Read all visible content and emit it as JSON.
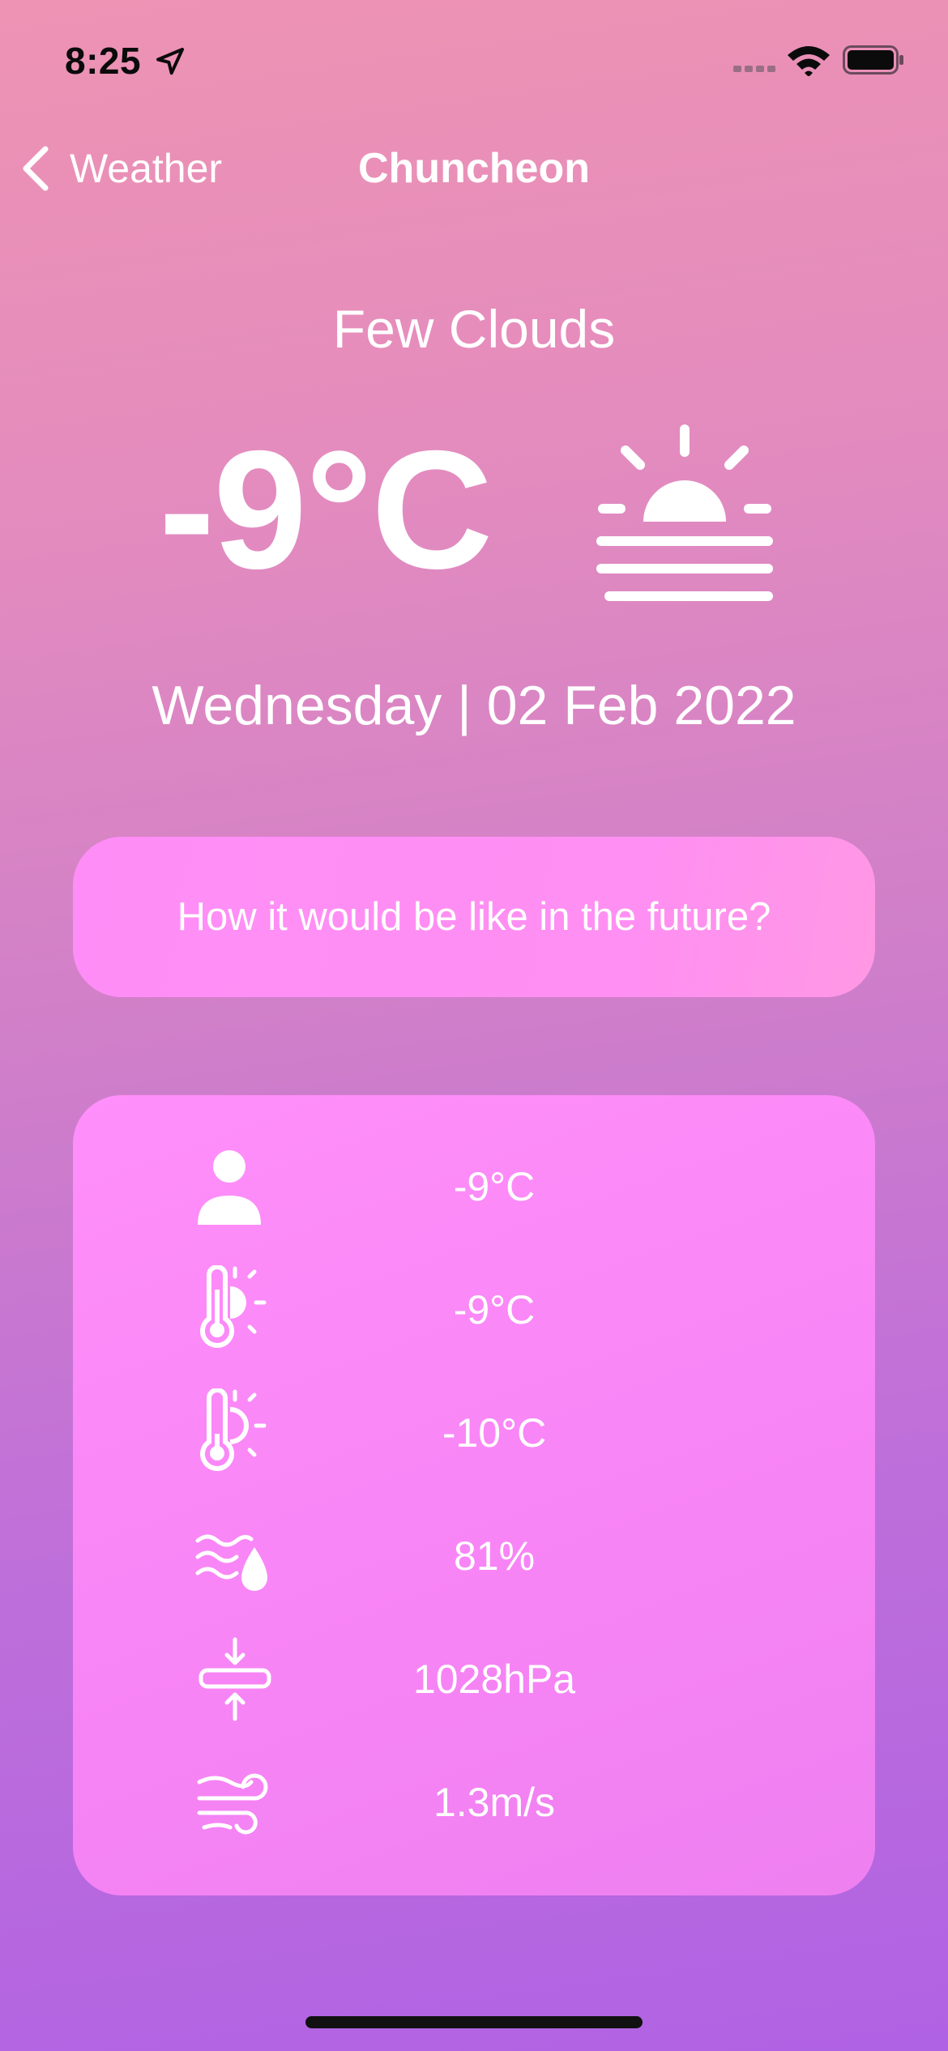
{
  "status_bar": {
    "time": "8:25",
    "location_icon": "location-arrow-icon",
    "signal_icon": "cellular-signal-icon",
    "wifi_icon": "wifi-icon",
    "battery_icon": "battery-full-icon"
  },
  "nav": {
    "back_label": "Weather",
    "back_icon": "chevron-left-icon",
    "title": "Chuncheon"
  },
  "current": {
    "condition": "Few Clouds",
    "temperature": "-9°C",
    "condition_icon": "sunrise-haze-icon",
    "date": "Wednesday | 02 Feb 2022"
  },
  "future_button": {
    "label": "How it would be like in the future?"
  },
  "details": [
    {
      "icon": "person-icon",
      "value": "-9°C"
    },
    {
      "icon": "thermometer-sun-icon",
      "value": "-9°C"
    },
    {
      "icon": "thermometer-sun-low-icon",
      "value": "-10°C"
    },
    {
      "icon": "humidity-icon",
      "value": "81%"
    },
    {
      "icon": "pressure-icon",
      "value": "1028hPa"
    },
    {
      "icon": "wind-icon",
      "value": "1.3m/s"
    }
  ],
  "colors": {
    "background_top": "#ee93b3",
    "background_bottom": "#b062e4",
    "card": "#ff8ffa",
    "text": "#ffffff"
  }
}
